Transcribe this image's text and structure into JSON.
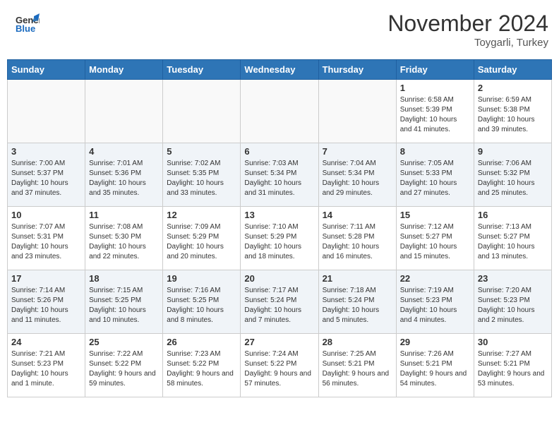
{
  "header": {
    "logo_general": "General",
    "logo_blue": "Blue",
    "month_title": "November 2024",
    "location": "Toygarli, Turkey"
  },
  "weekdays": [
    "Sunday",
    "Monday",
    "Tuesday",
    "Wednesday",
    "Thursday",
    "Friday",
    "Saturday"
  ],
  "weeks": [
    {
      "days": [
        {
          "num": "",
          "info": ""
        },
        {
          "num": "",
          "info": ""
        },
        {
          "num": "",
          "info": ""
        },
        {
          "num": "",
          "info": ""
        },
        {
          "num": "",
          "info": ""
        },
        {
          "num": "1",
          "info": "Sunrise: 6:58 AM\nSunset: 5:39 PM\nDaylight: 10 hours and 41 minutes."
        },
        {
          "num": "2",
          "info": "Sunrise: 6:59 AM\nSunset: 5:38 PM\nDaylight: 10 hours and 39 minutes."
        }
      ]
    },
    {
      "days": [
        {
          "num": "3",
          "info": "Sunrise: 7:00 AM\nSunset: 5:37 PM\nDaylight: 10 hours and 37 minutes."
        },
        {
          "num": "4",
          "info": "Sunrise: 7:01 AM\nSunset: 5:36 PM\nDaylight: 10 hours and 35 minutes."
        },
        {
          "num": "5",
          "info": "Sunrise: 7:02 AM\nSunset: 5:35 PM\nDaylight: 10 hours and 33 minutes."
        },
        {
          "num": "6",
          "info": "Sunrise: 7:03 AM\nSunset: 5:34 PM\nDaylight: 10 hours and 31 minutes."
        },
        {
          "num": "7",
          "info": "Sunrise: 7:04 AM\nSunset: 5:34 PM\nDaylight: 10 hours and 29 minutes."
        },
        {
          "num": "8",
          "info": "Sunrise: 7:05 AM\nSunset: 5:33 PM\nDaylight: 10 hours and 27 minutes."
        },
        {
          "num": "9",
          "info": "Sunrise: 7:06 AM\nSunset: 5:32 PM\nDaylight: 10 hours and 25 minutes."
        }
      ]
    },
    {
      "days": [
        {
          "num": "10",
          "info": "Sunrise: 7:07 AM\nSunset: 5:31 PM\nDaylight: 10 hours and 23 minutes."
        },
        {
          "num": "11",
          "info": "Sunrise: 7:08 AM\nSunset: 5:30 PM\nDaylight: 10 hours and 22 minutes."
        },
        {
          "num": "12",
          "info": "Sunrise: 7:09 AM\nSunset: 5:29 PM\nDaylight: 10 hours and 20 minutes."
        },
        {
          "num": "13",
          "info": "Sunrise: 7:10 AM\nSunset: 5:29 PM\nDaylight: 10 hours and 18 minutes."
        },
        {
          "num": "14",
          "info": "Sunrise: 7:11 AM\nSunset: 5:28 PM\nDaylight: 10 hours and 16 minutes."
        },
        {
          "num": "15",
          "info": "Sunrise: 7:12 AM\nSunset: 5:27 PM\nDaylight: 10 hours and 15 minutes."
        },
        {
          "num": "16",
          "info": "Sunrise: 7:13 AM\nSunset: 5:27 PM\nDaylight: 10 hours and 13 minutes."
        }
      ]
    },
    {
      "days": [
        {
          "num": "17",
          "info": "Sunrise: 7:14 AM\nSunset: 5:26 PM\nDaylight: 10 hours and 11 minutes."
        },
        {
          "num": "18",
          "info": "Sunrise: 7:15 AM\nSunset: 5:25 PM\nDaylight: 10 hours and 10 minutes."
        },
        {
          "num": "19",
          "info": "Sunrise: 7:16 AM\nSunset: 5:25 PM\nDaylight: 10 hours and 8 minutes."
        },
        {
          "num": "20",
          "info": "Sunrise: 7:17 AM\nSunset: 5:24 PM\nDaylight: 10 hours and 7 minutes."
        },
        {
          "num": "21",
          "info": "Sunrise: 7:18 AM\nSunset: 5:24 PM\nDaylight: 10 hours and 5 minutes."
        },
        {
          "num": "22",
          "info": "Sunrise: 7:19 AM\nSunset: 5:23 PM\nDaylight: 10 hours and 4 minutes."
        },
        {
          "num": "23",
          "info": "Sunrise: 7:20 AM\nSunset: 5:23 PM\nDaylight: 10 hours and 2 minutes."
        }
      ]
    },
    {
      "days": [
        {
          "num": "24",
          "info": "Sunrise: 7:21 AM\nSunset: 5:23 PM\nDaylight: 10 hours and 1 minute."
        },
        {
          "num": "25",
          "info": "Sunrise: 7:22 AM\nSunset: 5:22 PM\nDaylight: 9 hours and 59 minutes."
        },
        {
          "num": "26",
          "info": "Sunrise: 7:23 AM\nSunset: 5:22 PM\nDaylight: 9 hours and 58 minutes."
        },
        {
          "num": "27",
          "info": "Sunrise: 7:24 AM\nSunset: 5:22 PM\nDaylight: 9 hours and 57 minutes."
        },
        {
          "num": "28",
          "info": "Sunrise: 7:25 AM\nSunset: 5:21 PM\nDaylight: 9 hours and 56 minutes."
        },
        {
          "num": "29",
          "info": "Sunrise: 7:26 AM\nSunset: 5:21 PM\nDaylight: 9 hours and 54 minutes."
        },
        {
          "num": "30",
          "info": "Sunrise: 7:27 AM\nSunset: 5:21 PM\nDaylight: 9 hours and 53 minutes."
        }
      ]
    }
  ]
}
